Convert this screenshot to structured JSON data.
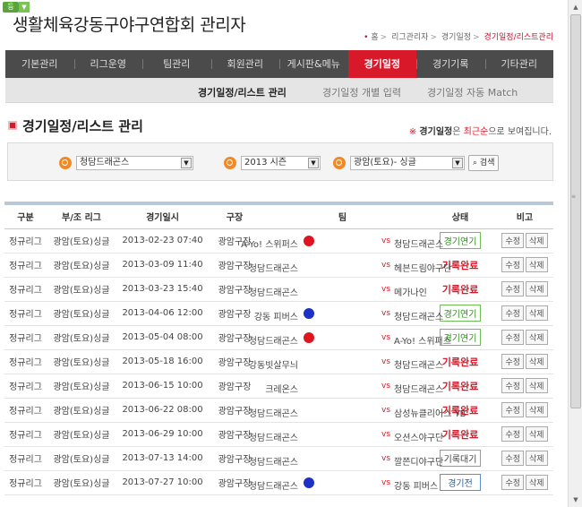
{
  "badge": "등",
  "site_title": "생활체육강동구야구연합회 관리자",
  "breadcrumb": [
    "홈",
    "리그관리자",
    "경기일정",
    "경기일정/리스트관리"
  ],
  "gnb": [
    "기본관리",
    "리그운영",
    "팀관리",
    "회원관리",
    "게시판&메뉴",
    "경기일정",
    "경기기록",
    "기타관리"
  ],
  "gnb_active": 5,
  "lnb": [
    "경기일정/리스트 관리",
    "경기일정 개별 입력",
    "경기일정 자동 Match"
  ],
  "page_title": "경기일정/리스트 관리",
  "note": {
    "mark": "※",
    "key": "경기일정",
    "mid": "은 ",
    "red": "최근순",
    "tail": "으로 보여집니다."
  },
  "filters": {
    "team": "청담드래곤스",
    "season": "2013 시즌",
    "league": "광암(토요)- 싱글",
    "search_label": "검색"
  },
  "columns": [
    "구분",
    "부/조 리그",
    "경기일시",
    "구장",
    "팀",
    "상태",
    "비고"
  ],
  "edit_label": "수정",
  "delete_label": "삭제",
  "rows": [
    {
      "type": "정규리그",
      "league": "광암(토요)싱글",
      "date": "2013-02-23  07:40",
      "field": "광암구장",
      "ball": "red",
      "home": "A-Yo! 스위퍼스",
      "vs": "vs",
      "away": "청담드래곤스",
      "status": "경기연기",
      "status_style": "green"
    },
    {
      "type": "정규리그",
      "league": "광암(토요)싱글",
      "date": "2013-03-09  11:40",
      "field": "광암구장",
      "ball": "",
      "home": "청담드래곤스",
      "vs": "vs",
      "away": "헤븐드림야구단",
      "status": "기록완료",
      "status_style": "red"
    },
    {
      "type": "정규리그",
      "league": "광암(토요)싱글",
      "date": "2013-03-23  15:40",
      "field": "광암구장",
      "ball": "",
      "home": "청담드래곤스",
      "vs": "vs",
      "away": "메가나인",
      "status": "기록완료",
      "status_style": "red"
    },
    {
      "type": "정규리그",
      "league": "광암(토요)싱글",
      "date": "2013-04-06  12:00",
      "field": "광암구장",
      "ball": "blue",
      "home": "강동 피버스",
      "vs": "vs",
      "away": "청담드래곤스",
      "status": "경기연기",
      "status_style": "green"
    },
    {
      "type": "정규리그",
      "league": "광암(토요)싱글",
      "date": "2013-05-04  08:00",
      "field": "광암구장",
      "ball": "red",
      "home": "청담드래곤스",
      "vs": "vs",
      "away": "A-Yo! 스위퍼스",
      "status": "경기연기",
      "status_style": "green"
    },
    {
      "type": "정규리그",
      "league": "광암(토요)싱글",
      "date": "2013-05-18  16:00",
      "field": "광암구장",
      "ball": "",
      "home": "강동빗살무늬",
      "vs": "vs",
      "away": "청담드래곤스",
      "status": "기록완료",
      "status_style": "red"
    },
    {
      "type": "정규리그",
      "league": "광암(토요)싱글",
      "date": "2013-06-15  10:00",
      "field": "광암구장",
      "ball": "",
      "home": "크레온스",
      "vs": "vs",
      "away": "청담드래곤스",
      "status": "기록완료",
      "status_style": "red"
    },
    {
      "type": "정규리그",
      "league": "광암(토요)싱글",
      "date": "2013-06-22  08:00",
      "field": "광암구장",
      "ball": "",
      "home": "청담드래곤스",
      "vs": "vs",
      "away": "삼성뉴클리어스 YB",
      "status": "기록완료",
      "status_style": "red"
    },
    {
      "type": "정규리그",
      "league": "광암(토요)싱글",
      "date": "2013-06-29  10:00",
      "field": "광암구장",
      "ball": "",
      "home": "청담드래곤스",
      "vs": "vs",
      "away": "오션스야구단",
      "status": "기록완료",
      "status_style": "red"
    },
    {
      "type": "정규리그",
      "league": "광암(토요)싱글",
      "date": "2013-07-13  14:00",
      "field": "광암구장",
      "ball": "",
      "home": "청담드래곤스",
      "vs": "vs",
      "away": "깔쯘디야구단",
      "status": "기록대기",
      "status_style": "gray"
    },
    {
      "type": "정규리그",
      "league": "광암(토요)싱글",
      "date": "2013-07-27  10:00",
      "field": "광암구장",
      "ball": "blue",
      "home": "청담드래곤스",
      "vs": "vs",
      "away": "강동 피버스",
      "status": "경기전",
      "status_style": "blue"
    }
  ]
}
